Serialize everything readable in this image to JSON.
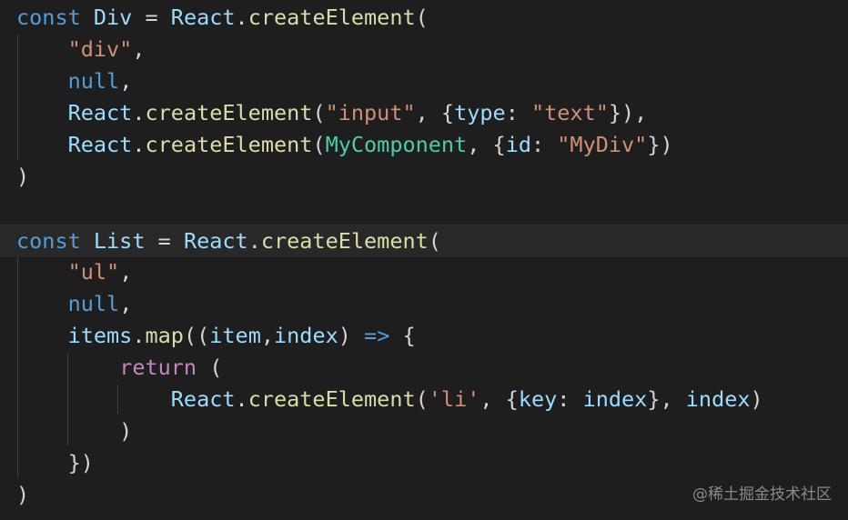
{
  "colors": {
    "background": "#1e1e1e",
    "current_line": "#282828",
    "indent_guide": "#404040",
    "keyword": "#569cd6",
    "control_keyword": "#c586c0",
    "variable": "#9cdcfe",
    "function": "#dcdcaa",
    "string": "#ce9178",
    "component": "#4ec9b0",
    "punctuation": "#d4d4d4",
    "watermark": "#8a8a8a"
  },
  "code": {
    "lines": [
      [
        [
          "kw",
          "const "
        ],
        [
          "var",
          "Div"
        ],
        [
          "pun",
          " = "
        ],
        [
          "var",
          "React"
        ],
        [
          "pun",
          "."
        ],
        [
          "fn",
          "createElement"
        ],
        [
          "pun",
          "("
        ]
      ],
      [
        [
          "pun",
          "    "
        ],
        [
          "str",
          "\"div\""
        ],
        [
          "pun",
          ","
        ]
      ],
      [
        [
          "pun",
          "    "
        ],
        [
          "kw",
          "null"
        ],
        [
          "pun",
          ","
        ]
      ],
      [
        [
          "pun",
          "    "
        ],
        [
          "var",
          "React"
        ],
        [
          "pun",
          "."
        ],
        [
          "fn",
          "createElement"
        ],
        [
          "pun",
          "("
        ],
        [
          "str",
          "\"input\""
        ],
        [
          "pun",
          ", {"
        ],
        [
          "var",
          "type"
        ],
        [
          "pun",
          ": "
        ],
        [
          "str",
          "\"text\""
        ],
        [
          "pun",
          "}),"
        ]
      ],
      [
        [
          "pun",
          "    "
        ],
        [
          "var",
          "React"
        ],
        [
          "pun",
          "."
        ],
        [
          "fn",
          "createElement"
        ],
        [
          "pun",
          "("
        ],
        [
          "cls",
          "MyComponent"
        ],
        [
          "pun",
          ", {"
        ],
        [
          "var",
          "id"
        ],
        [
          "pun",
          ": "
        ],
        [
          "str",
          "\"MyDiv\""
        ],
        [
          "pun",
          "})"
        ]
      ],
      [
        [
          "pun",
          ")"
        ]
      ],
      [],
      [
        [
          "kw",
          "const "
        ],
        [
          "var",
          "List"
        ],
        [
          "pun",
          " = "
        ],
        [
          "var",
          "React"
        ],
        [
          "pun",
          "."
        ],
        [
          "fn",
          "createElement"
        ],
        [
          "pun",
          "("
        ]
      ],
      [
        [
          "pun",
          "    "
        ],
        [
          "str",
          "\"ul\""
        ],
        [
          "pun",
          ","
        ]
      ],
      [
        [
          "pun",
          "    "
        ],
        [
          "kw",
          "null"
        ],
        [
          "pun",
          ","
        ]
      ],
      [
        [
          "pun",
          "    "
        ],
        [
          "var",
          "items"
        ],
        [
          "pun",
          "."
        ],
        [
          "fn",
          "map"
        ],
        [
          "pun",
          "(("
        ],
        [
          "var",
          "item"
        ],
        [
          "pun",
          ","
        ],
        [
          "var",
          "index"
        ],
        [
          "pun",
          ") "
        ],
        [
          "kw",
          "=>"
        ],
        [
          "pun",
          " {"
        ]
      ],
      [
        [
          "pun",
          "        "
        ],
        [
          "ctl",
          "return"
        ],
        [
          "pun",
          " ("
        ]
      ],
      [
        [
          "pun",
          "            "
        ],
        [
          "var",
          "React"
        ],
        [
          "pun",
          "."
        ],
        [
          "fn",
          "createElement"
        ],
        [
          "pun",
          "("
        ],
        [
          "str",
          "'li'"
        ],
        [
          "pun",
          ", {"
        ],
        [
          "var",
          "key"
        ],
        [
          "pun",
          ": "
        ],
        [
          "var",
          "index"
        ],
        [
          "pun",
          "}, "
        ],
        [
          "var",
          "index"
        ],
        [
          "pun",
          ")"
        ]
      ],
      [
        [
          "pun",
          "        )"
        ]
      ],
      [
        [
          "pun",
          "    })"
        ]
      ],
      [
        [
          "pun",
          ")"
        ]
      ]
    ]
  },
  "watermark": "@稀土掘金技术社区"
}
